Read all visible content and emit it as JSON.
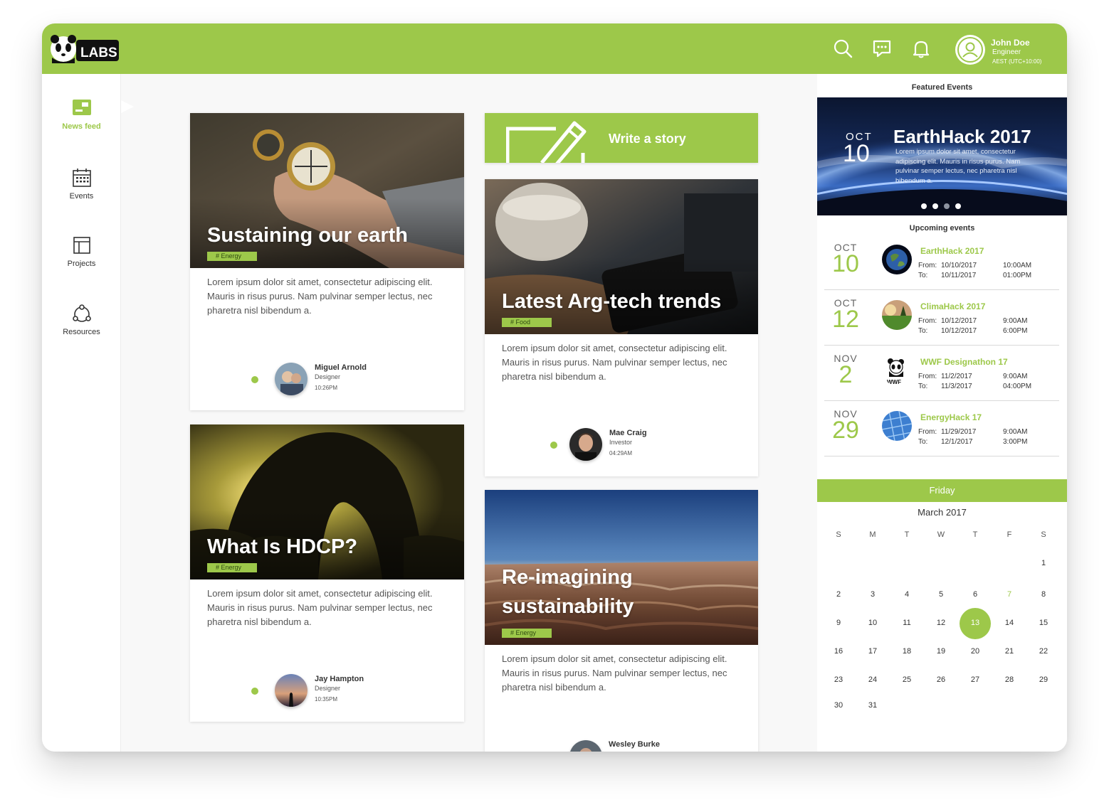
{
  "app": {
    "logo_text": "LABS"
  },
  "topbar": {
    "icons": [
      "search-icon",
      "chat-icon",
      "bell-icon"
    ],
    "user": {
      "name": "John Doe",
      "role": "Engineer",
      "timezone": "AEST (UTC+10:00)"
    }
  },
  "nav": {
    "items": [
      {
        "label": "News feed",
        "icon": "newsfeed-icon",
        "active": true
      },
      {
        "label": "Events",
        "icon": "calendar-icon",
        "active": false
      },
      {
        "label": "Projects",
        "icon": "projects-icon",
        "active": false
      },
      {
        "label": "Resources",
        "icon": "resources-icon",
        "active": false
      }
    ]
  },
  "write_story": {
    "label": "Write a story"
  },
  "feed": [
    {
      "title": "Sustaining our earth",
      "tag": "# Energy",
      "body": "Lorem ipsum dolor sit amet, consectetur adipiscing elit. Mauris in risus purus. Nam pulvinar semper lectus, nec pharetra nisl bibendum a.",
      "author": {
        "name": "Miguel Arnold",
        "role": "Designer",
        "time": "10:26PM"
      }
    },
    {
      "title": "What Is HDCP?",
      "tag": "# Energy",
      "body": "Lorem ipsum dolor sit amet, consectetur adipiscing elit. Mauris in risus purus. Nam pulvinar semper lectus, nec pharetra nisl bibendum a.",
      "author": {
        "name": "Jay Hampton",
        "role": "Designer",
        "time": "10:35PM"
      }
    },
    {
      "title": "Latest Arg-tech trends",
      "tag": "# Food",
      "body": "Lorem ipsum dolor sit amet, consectetur adipiscing elit. Mauris in risus purus. Nam pulvinar semper lectus, nec pharetra nisl bibendum a.",
      "author": {
        "name": "Mae Craig",
        "role": "Investor",
        "time": "04:29AM"
      }
    },
    {
      "title_line1": "Re-imagining",
      "title_line2": "sustainability",
      "tag": "# Energy",
      "body": "Lorem ipsum dolor sit amet, consectetur adipiscing elit. Mauris in risus purus. Nam pulvinar semper lectus, nec pharetra nisl bibendum a.",
      "author": {
        "name": "Wesley Burke"
      }
    }
  ],
  "featured": {
    "heading": "Featured Events",
    "month": "OCT",
    "day": "10",
    "title": "EarthHack 2017",
    "description": "Lorem ipsum dolor sit amet, consectetur adipiscing elit. Mauris in risus purus. Nam pulvinar semper lectus, nec pharetra nisl bibendum a.",
    "slide_count": 4,
    "active_slide": 3
  },
  "upcoming": {
    "heading": "Upcoming events",
    "from_label": "From:",
    "to_label": "To:",
    "events": [
      {
        "month": "OCT",
        "day": "10",
        "title": "EarthHack 2017",
        "from_date": "10/10/2017",
        "from_time": "10:00AM",
        "to_date": "10/11/2017",
        "to_time": "01:00PM"
      },
      {
        "month": "OCT",
        "day": "12",
        "title": "ClimaHack 2017",
        "from_date": "10/12/2017",
        "from_time": "9:00AM",
        "to_date": "10/12/2017",
        "to_time": "6:00PM"
      },
      {
        "month": "NOV",
        "day": "2",
        "title": "WWF Designathon 17",
        "from_date": "11/2/2017",
        "from_time": "9:00AM",
        "to_date": "11/3/2017",
        "to_time": "04:00PM"
      },
      {
        "month": "NOV",
        "day": "29",
        "title": "EnergyHack 17",
        "from_date": "11/29/2017",
        "from_time": "9:00AM",
        "to_date": "12/1/2017",
        "to_time": "3:00PM"
      }
    ]
  },
  "calendar": {
    "weekday": "Friday",
    "month_label": "March 2017",
    "day_headers": [
      "S",
      "M",
      "T",
      "W",
      "T",
      "F",
      "S"
    ],
    "weeks": [
      [
        "",
        "",
        "",
        "",
        "",
        "",
        "1"
      ],
      [
        "2",
        "3",
        "4",
        "5",
        "6",
        "7",
        "8"
      ],
      [
        "9",
        "10",
        "11",
        "12",
        "13",
        "14",
        "15"
      ],
      [
        "16",
        "17",
        "18",
        "19",
        "20",
        "21",
        "22"
      ],
      [
        "23",
        "24",
        "25",
        "26",
        "27",
        "28",
        "29"
      ],
      [
        "30",
        "31",
        "",
        "",
        "",
        "",
        ""
      ]
    ],
    "selected_day": "13",
    "highlighted_day": "7"
  },
  "colors": {
    "accent": "#9dc84a",
    "background": "#f8f8f8"
  }
}
